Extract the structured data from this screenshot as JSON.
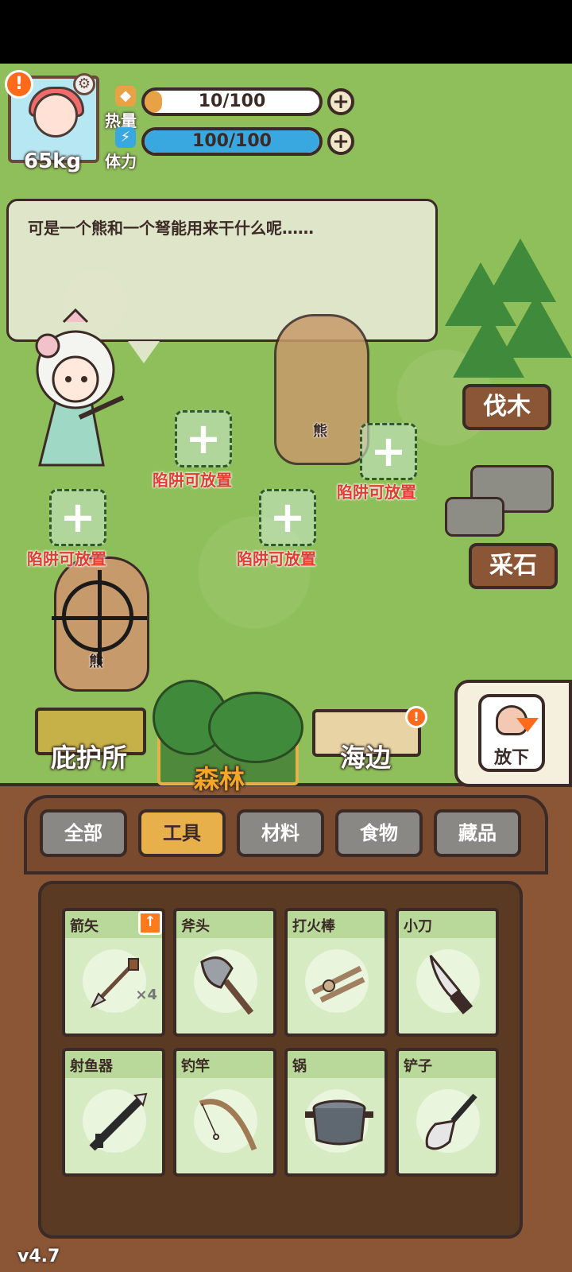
{
  "hud": {
    "weight": "65kg",
    "alert_icon": "!",
    "settings_icon": "⚙",
    "calories": {
      "label": "热量",
      "value_text": "10/100",
      "fill": 0.1,
      "color": "#e8a245",
      "plus": "+"
    },
    "stamina": {
      "label": "体力",
      "value_text": "100/100",
      "fill": 1.0,
      "color": "#3aa8e0",
      "plus": "+"
    }
  },
  "dialog": {
    "text": "可是一个熊和一个弩能用来干什么呢……"
  },
  "bears": [
    {
      "name": "熊"
    },
    {
      "name": "熊"
    }
  ],
  "traps": [
    {
      "label": "陷阱可放置",
      "plus": "+"
    },
    {
      "label": "陷阱可放置",
      "plus": "+"
    },
    {
      "label": "陷阱可放置",
      "plus": "+"
    },
    {
      "label": "陷阱可放置",
      "plus": "+"
    }
  ],
  "signs": {
    "chop": "伐木",
    "mine": "采石"
  },
  "locations": {
    "shelter": "庇护所",
    "forest": "森林",
    "seaside": "海边",
    "seaside_badge": "!"
  },
  "drop_button": {
    "label": "放下"
  },
  "categories": [
    {
      "label": "全部",
      "active": false
    },
    {
      "label": "工具",
      "active": true
    },
    {
      "label": "材料",
      "active": false
    },
    {
      "label": "食物",
      "active": false
    },
    {
      "label": "藏品",
      "active": false
    }
  ],
  "items": [
    {
      "name": "箭矢",
      "icon": "arrow-icon",
      "count": "×4",
      "upgrade": "↑"
    },
    {
      "name": "斧头",
      "icon": "axe-icon"
    },
    {
      "name": "打火棒",
      "icon": "fire-starter-icon"
    },
    {
      "name": "小刀",
      "icon": "knife-icon"
    },
    {
      "name": "射鱼器",
      "icon": "fish-gun-icon"
    },
    {
      "name": "钓竿",
      "icon": "fishing-rod-icon"
    },
    {
      "name": "锅",
      "icon": "pot-icon"
    },
    {
      "name": "铲子",
      "icon": "shovel-icon"
    }
  ],
  "version": "v4.7"
}
